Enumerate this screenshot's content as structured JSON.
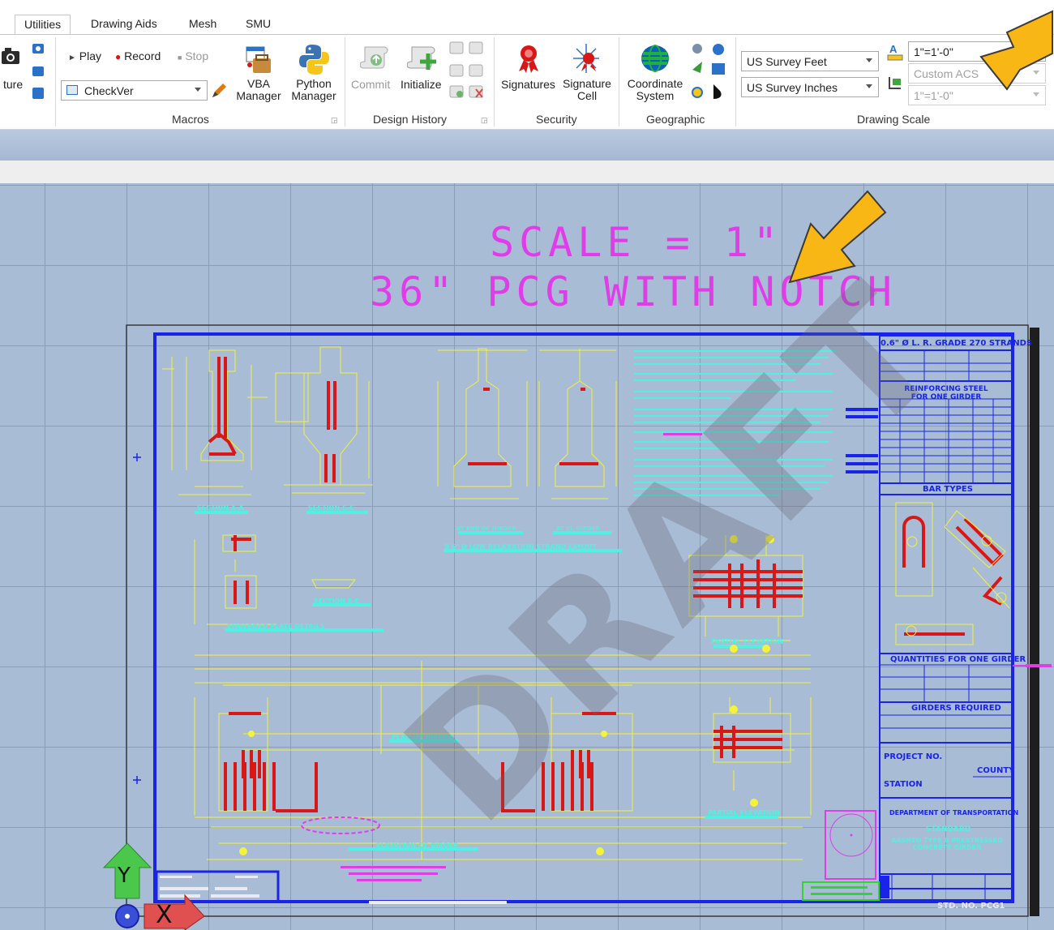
{
  "tabs": [
    "Utilities",
    "Drawing Aids",
    "Mesh",
    "SMU"
  ],
  "ribbon": {
    "capture_label": "ture",
    "macros": {
      "play": "Play",
      "record": "Record",
      "stop": "Stop",
      "macro_select": "CheckVer",
      "vba_manager": [
        "VBA",
        "Manager"
      ],
      "python_manager": [
        "Python",
        "Manager"
      ],
      "group_label": "Macros"
    },
    "design_history": {
      "commit": "Commit",
      "initialize": "Initialize",
      "group_label": "Design History"
    },
    "security": {
      "signatures": "Signatures",
      "signature_cell": [
        "Signature",
        "Cell"
      ],
      "group_label": "Security"
    },
    "geographic": {
      "coordinate_system": [
        "Coordinate",
        "System"
      ],
      "group_label": "Geographic"
    },
    "drawing_scale": {
      "units_primary": "US Survey Feet",
      "units_secondary": "US Survey Inches",
      "scale_value": "1\"=1'-0\"",
      "acs_value": "Custom ACS",
      "scale_secondary": "1\"=1'-0\"",
      "group_label": "Drawing Scale"
    }
  },
  "drawing": {
    "scale_line": "SCALE = 1\"",
    "title_line": "36\" PCG WITH NOTCH",
    "watermark": "DRAFT",
    "title_block": {
      "strand_header": "0.6\" Ø L. R. GRADE 270 STRANDS",
      "reinforcing": "REINFORCING STEEL FOR ONE GIRDER",
      "bar_types": "BAR TYPES",
      "quantities": "QUANTITIES FOR ONE GIRDER",
      "girders_required": "GIRDERS REQUIRED",
      "project_no": "PROJECT NO.",
      "county": "COUNTY",
      "station": "STATION",
      "department": "DEPARTMENT OF TRANSPORTATION",
      "standard": "STANDARD",
      "girder_type": "AASHTO TYPE II PRESTRESSED CONCRETE GIRDER",
      "std_no": "STD. NO. PCG1"
    },
    "views": {
      "section_aa": "SECTION A-A",
      "section_cc": "SECTION C-C",
      "end_of_girder": "AT END OF GIRDER",
      "at_cl_girder": "AT CL GIRDER",
      "strand_layout": "0.6\" Ø LOW RELAXATION STRAND LAYOUT",
      "embedded_plate": "EMBEDDED PLATE DETAILS",
      "section_e": "SECTION E-E",
      "partial_elevation": "PARTIAL ELEVATION",
      "plan_of_girder": "PLAN OF GIRDER",
      "elevation_of_girder": "ELEVATION OF GIRDER"
    },
    "axis_labels": {
      "y": "Y",
      "x": "X"
    }
  },
  "colors": {
    "magenta": "#e03ce8",
    "callout_arrow": "#f9b716",
    "border_blue": "#1a24e8",
    "detail_yellow": "#f4f23a",
    "rebar_red": "#d81717",
    "background": "#a9bcd5"
  },
  "icons": {
    "capture": "camera-icon",
    "play": "play-icon",
    "record": "record-icon",
    "stop": "stop-icon",
    "vba": "vba-icon",
    "python": "python-icon",
    "signatures": "signature-icon",
    "coordinate": "globe-icon"
  }
}
